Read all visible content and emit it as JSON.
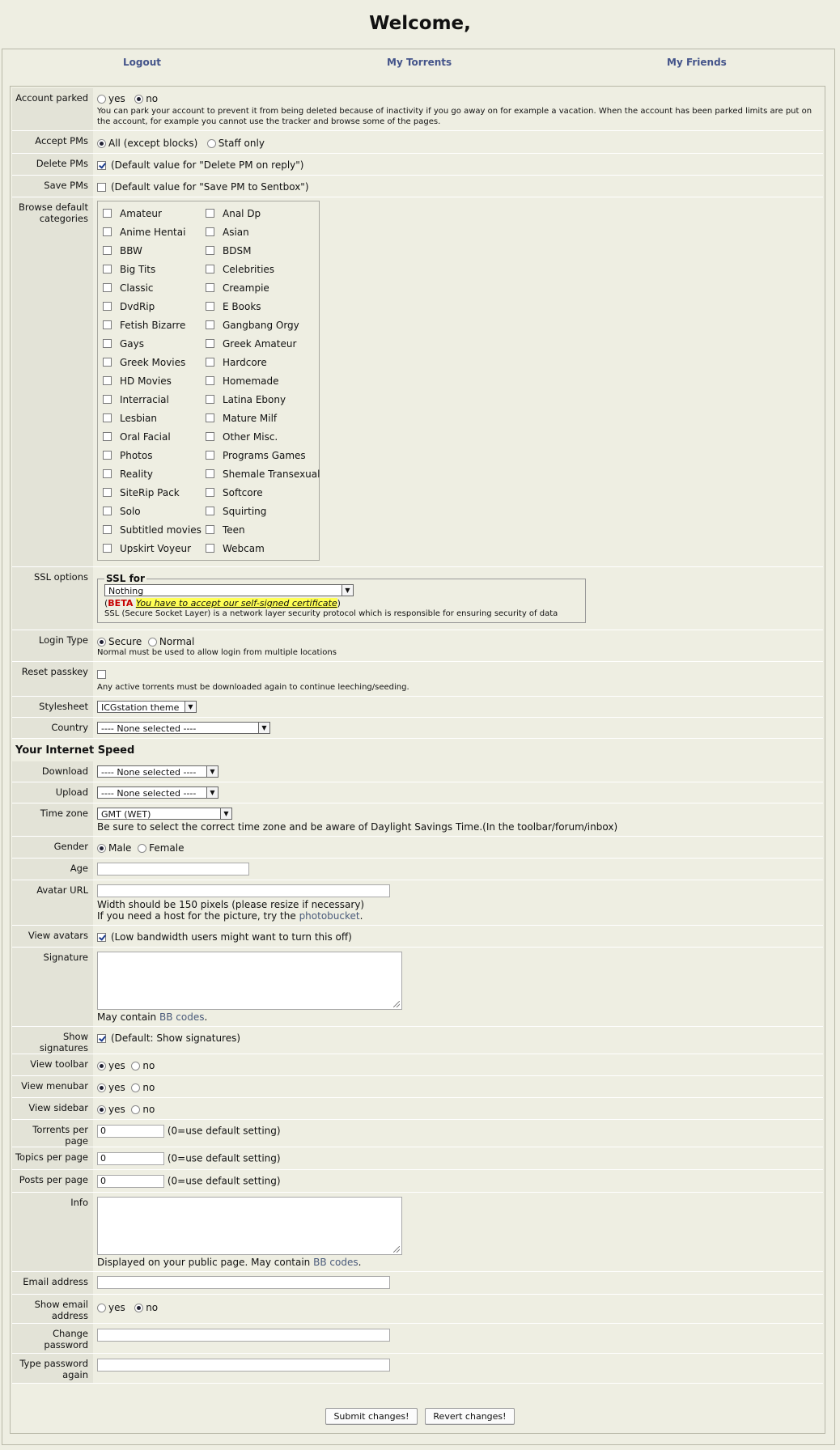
{
  "page": {
    "title": "Welcome,"
  },
  "nav": {
    "logout": "Logout",
    "my_torrents": "My Torrents",
    "my_friends": "My Friends"
  },
  "account_parked": {
    "label": "Account parked",
    "yes": "yes",
    "no": "no",
    "selected": "no",
    "help": "You can park your account to prevent it from being deleted because of inactivity if you go away on for example a vacation. When the account has been parked limits are put on the account, for example you cannot use the tracker and browse some of the pages."
  },
  "accept_pms": {
    "label": "Accept PMs",
    "all": "All (except blocks)",
    "staff": "Staff only",
    "selected": "all"
  },
  "delete_pms": {
    "label": "Delete PMs",
    "text": "(Default value for \"Delete PM on reply\")",
    "checked": true
  },
  "save_pms": {
    "label": "Save PMs",
    "text": "(Default value for \"Save PM to Sentbox\")",
    "checked": false
  },
  "categories": {
    "label": "Browse default categories",
    "items": [
      "Amateur",
      "Anal Dp",
      "Anime Hentai",
      "Asian",
      "BBW",
      "BDSM",
      "Big Tits",
      "Celebrities",
      "Classic",
      "Creampie",
      "DvdRip",
      "E Books",
      "Fetish Bizarre",
      "Gangbang Orgy",
      "Gays",
      "Greek Amateur",
      "Greek Movies",
      "Hardcore",
      "HD Movies",
      "Homemade",
      "Interracial",
      "Latina Ebony",
      "Lesbian",
      "Mature Milf",
      "Oral Facial",
      "Other Misc.",
      "Photos",
      "Programs Games",
      "Reality",
      "Shemale Transexual",
      "SiteRip Pack",
      "Softcore",
      "Solo",
      "Squirting",
      "Subtitled movies",
      "Teen",
      "Upskirt Voyeur",
      "Webcam"
    ]
  },
  "ssl": {
    "label": "SSL options",
    "legend": "SSL for",
    "value": "Nothing",
    "beta": "BETA",
    "cert_link": "You have to accept our self-signed certificate",
    "help": "SSL (Secure Socket Layer) is a network layer security protocol which is responsible for ensuring security of data"
  },
  "login_type": {
    "label": "Login Type",
    "secure": "Secure",
    "normal": "Normal",
    "selected": "secure",
    "help": "Normal must be used to allow login from multiple locations"
  },
  "reset_passkey": {
    "label": "Reset passkey",
    "help": "Any active torrents must be downloaded again to continue leeching/seeding."
  },
  "stylesheet": {
    "label": "Stylesheet",
    "value": "ICGstation theme"
  },
  "country": {
    "label": "Country",
    "value": "---- None selected ----"
  },
  "speed": {
    "section": "Your Internet Speed",
    "download_label": "Download",
    "download_value": "---- None selected ----",
    "upload_label": "Upload",
    "upload_value": "---- None selected ----"
  },
  "timezone": {
    "label": "Time zone",
    "value": "GMT (WET)",
    "help": "Be sure to select the correct time zone and be aware of Daylight Savings Time.(In the toolbar/forum/inbox)"
  },
  "gender": {
    "label": "Gender",
    "male": "Male",
    "female": "Female",
    "selected": "male"
  },
  "age": {
    "label": "Age"
  },
  "avatar_url": {
    "label": "Avatar URL",
    "help1": "Width should be 150 pixels (please resize if necessary)",
    "help2_prefix": "If you need a host for the picture, try the ",
    "help2_link": "photobucket",
    "help2_suffix": "."
  },
  "view_avatars": {
    "label": "View avatars",
    "text": "(Low bandwidth users might want to turn this off)",
    "checked": true
  },
  "signature": {
    "label": "Signature",
    "help_prefix": "May contain ",
    "help_link": "BB codes",
    "help_suffix": "."
  },
  "show_signatures": {
    "label": "Show signatures",
    "text": "(Default: Show signatures)",
    "checked": true
  },
  "view_toolbar": {
    "label": "View toolbar",
    "yes": "yes",
    "no": "no",
    "selected": "yes"
  },
  "view_menubar": {
    "label": "View menubar",
    "yes": "yes",
    "no": "no",
    "selected": "yes"
  },
  "view_sidebar": {
    "label": "View sidebar",
    "yes": "yes",
    "no": "no",
    "selected": "yes"
  },
  "torrents_per_page": {
    "label": "Torrents per page",
    "value": "0",
    "help": "(0=use default setting)"
  },
  "topics_per_page": {
    "label": "Topics per page",
    "value": "0",
    "help": "(0=use default setting)"
  },
  "posts_per_page": {
    "label": "Posts per page",
    "value": "0",
    "help": "(0=use default setting)"
  },
  "info": {
    "label": "Info",
    "help_prefix": "Displayed on your public page. May contain ",
    "help_link": "BB codes",
    "help_suffix": "."
  },
  "email": {
    "label": "Email address"
  },
  "show_email": {
    "label": "Show email address",
    "yes": "yes",
    "no": "no",
    "selected": "no"
  },
  "change_password": {
    "label": "Change password"
  },
  "password_again": {
    "label": "Type password again"
  },
  "buttons": {
    "submit": "Submit changes!",
    "revert": "Revert changes!"
  }
}
